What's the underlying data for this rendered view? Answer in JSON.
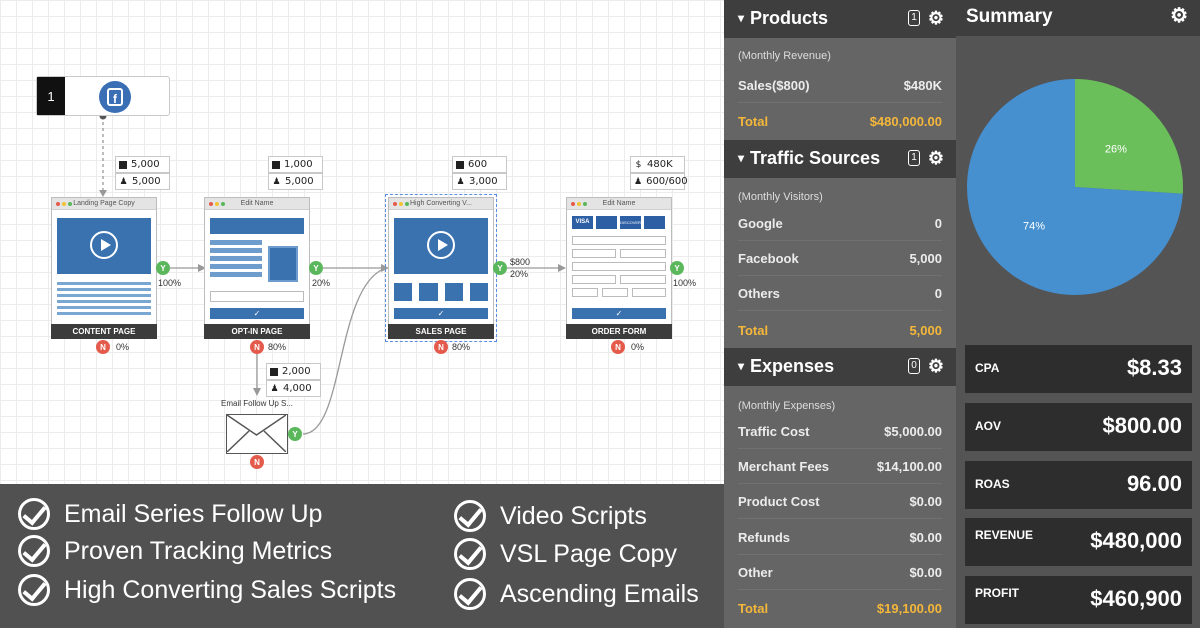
{
  "funnel": {
    "source": {
      "number": "1",
      "icon": "facebook-icon"
    },
    "steps": [
      {
        "title": "Landing Page Copy",
        "label": "CONTENT PAGE",
        "stats": [
          {
            "icon": "checkbox-icon",
            "value": "5,000"
          },
          {
            "icon": "person-icon",
            "value": "5,000"
          }
        ],
        "yes_percent": "100%",
        "no_percent": "0%"
      },
      {
        "title": "Edit Name",
        "label": "OPT-IN PAGE",
        "stats": [
          {
            "icon": "checkbox-icon",
            "value": "1,000"
          },
          {
            "icon": "person-icon",
            "value": "5,000"
          }
        ],
        "yes_percent": "20%",
        "no_percent": "80%"
      },
      {
        "title": "High Converting V...",
        "label": "SALES PAGE",
        "stats": [
          {
            "icon": "checkbox-icon",
            "value": "600"
          },
          {
            "icon": "person-icon",
            "value": "3,000"
          }
        ],
        "yes_value": "$800",
        "yes_percent": "20%",
        "no_percent": "80%"
      },
      {
        "title": "Edit Name",
        "label": "ORDER FORM",
        "stats": [
          {
            "icon": "dollar-icon",
            "value": "480K"
          },
          {
            "icon": "person-icon",
            "value": "600/600"
          }
        ],
        "yes_percent": "100%",
        "no_percent": "0%"
      }
    ],
    "email": {
      "title": "Email Follow Up S...",
      "stats": [
        {
          "icon": "checkbox-icon",
          "value": "2,000"
        },
        {
          "icon": "person-icon",
          "value": "4,000"
        }
      ]
    },
    "yes_badge": "Y",
    "no_badge": "N"
  },
  "benefits": [
    "Email Series Follow Up",
    "Proven Tracking Metrics",
    "High Converting Sales Scripts",
    "Video Scripts",
    "VSL Page Copy",
    "Ascending Emails"
  ],
  "panel": {
    "products": {
      "title": "Products",
      "count": "1",
      "subtitle": "(Monthly Revenue)",
      "rows": [
        {
          "label": "Sales($800)",
          "value": "$480K"
        }
      ],
      "total": {
        "label": "Total",
        "value": "$480,000.00"
      }
    },
    "traffic": {
      "title": "Traffic Sources",
      "count": "1",
      "subtitle": "(Monthly Visitors)",
      "rows": [
        {
          "label": "Google",
          "value": "0"
        },
        {
          "label": "Facebook",
          "value": "5,000"
        },
        {
          "label": "Others",
          "value": "0"
        }
      ],
      "total": {
        "label": "Total",
        "value": "5,000"
      }
    },
    "expenses": {
      "title": "Expenses",
      "count": "0",
      "subtitle": "(Monthly Expenses)",
      "rows": [
        {
          "label": "Traffic Cost",
          "value": "$5,000.00"
        },
        {
          "label": "Merchant Fees",
          "value": "$14,100.00"
        },
        {
          "label": "Product Cost",
          "value": "$0.00"
        },
        {
          "label": "Refunds",
          "value": "$0.00"
        },
        {
          "label": "Other",
          "value": "$0.00"
        }
      ],
      "total": {
        "label": "Total",
        "value": "$19,100.00"
      }
    }
  },
  "summary": {
    "title": "Summary",
    "metrics": [
      {
        "label": "CPA",
        "value": "$8.33"
      },
      {
        "label": "AOV",
        "value": "$800.00"
      },
      {
        "label": "ROAS",
        "value": "96.00"
      },
      {
        "label": "REVENUE",
        "value": "$480,000"
      },
      {
        "label": "PROFIT",
        "value": "$460,900"
      }
    ]
  },
  "chart_data": {
    "type": "pie",
    "values": [
      26,
      74
    ],
    "labels": [
      "26%",
      "74%"
    ],
    "colors": [
      "#6abf5a",
      "#4690d0"
    ]
  },
  "colors": {
    "accent_total": "#f4b73a",
    "yes": "#5bb75b",
    "no": "#e45a4b",
    "video_blue": "#3a72b0"
  }
}
